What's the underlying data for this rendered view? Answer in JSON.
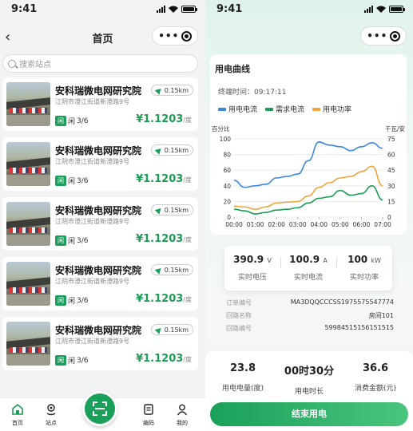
{
  "left": {
    "status_time": "9:41",
    "title": "首页",
    "search_placeholder": "搜索站点",
    "stations": [
      {
        "name": "安科瑞微电网研究院",
        "address": "江阴市澄江街道新澄路9号",
        "distance": "0.15km",
        "free_tag": "闲",
        "free_label": "闲",
        "available": "3/6",
        "price": "¥1.1203",
        "price_unit": "/度"
      },
      {
        "name": "安科瑞微电网研究院",
        "address": "江阴市澄江街道新澄路9号",
        "distance": "0.15km",
        "free_tag": "闲",
        "free_label": "闲",
        "available": "3/6",
        "price": "¥1.1203",
        "price_unit": "/度"
      },
      {
        "name": "安科瑞微电网研究院",
        "address": "江阴市澄江街道新澄路9号",
        "distance": "0.15km",
        "free_tag": "闲",
        "free_label": "闲",
        "available": "3/6",
        "price": "¥1.1203",
        "price_unit": "/度"
      },
      {
        "name": "安科瑞微电网研究院",
        "address": "江阴市澄江街道新澄路9号",
        "distance": "0.15km",
        "free_tag": "闲",
        "free_label": "闲",
        "available": "3/6",
        "price": "¥1.1203",
        "price_unit": "/度"
      },
      {
        "name": "安科瑞微电网研究院",
        "address": "江阴市澄江街道新澄路9号",
        "distance": "0.15km",
        "free_tag": "闲",
        "free_label": "闲",
        "available": "3/6",
        "price": "¥1.1203",
        "price_unit": "/度"
      }
    ],
    "tabs": [
      {
        "label": "首页",
        "icon": "home-icon"
      },
      {
        "label": "站点",
        "icon": "location-icon"
      },
      {
        "label": "编码",
        "icon": "code-icon"
      },
      {
        "label": "我的",
        "icon": "user-icon"
      }
    ],
    "scan_icon": "scan-icon"
  },
  "right": {
    "status_time": "9:41",
    "chart_title": "用电曲线",
    "terminal_time_label": "终端时间：",
    "terminal_time": "09:17:11",
    "stats": [
      {
        "value": "390.9",
        "unit": "V",
        "label": "实时电压"
      },
      {
        "value": "100.9",
        "unit": "A",
        "label": "实时电流"
      },
      {
        "value": "100",
        "unit": "kW",
        "label": "实时功率"
      }
    ],
    "info": [
      {
        "key": "订单编号",
        "value": "MA3DQQCCCSS1975575547774"
      },
      {
        "key": "回路名称",
        "value": "房间101"
      },
      {
        "key": "回路编号",
        "value": "59984515156151515"
      }
    ],
    "bottom_stats": [
      {
        "value": "23.8",
        "label": "用电电量(度)"
      },
      {
        "value": "00时30分",
        "label": "用电时长"
      },
      {
        "value": "36.6",
        "label": "消费金额(元)"
      }
    ],
    "end_button": "结束用电"
  },
  "chart_data": {
    "type": "line",
    "title": "用电曲线",
    "x": [
      "00:00",
      "01:00",
      "02:00",
      "03:00",
      "04:00",
      "05:00",
      "06:00",
      "07:00"
    ],
    "ylabel_left": "百分比",
    "ylabel_right": "千瓦/安",
    "ylim_left": [
      0,
      100
    ],
    "ylim_right": [
      0,
      75
    ],
    "yticks_left": [
      "0",
      "20",
      "40",
      "60",
      "80",
      "100"
    ],
    "yticks_right": [
      "0",
      "15",
      "30",
      "45",
      "60",
      "75"
    ],
    "grid": true,
    "legend": "top-left",
    "series": [
      {
        "name": "用电电流",
        "color": "#3b86e0",
        "x": [
          0,
          0.5,
          1,
          1.5,
          2,
          2.5,
          3,
          3.5,
          4,
          4.5,
          5,
          5.5,
          6,
          6.5,
          7
        ],
        "values": [
          47,
          38,
          40,
          42,
          50,
          52,
          55,
          72,
          96,
          92,
          90,
          85,
          90,
          95,
          88
        ]
      },
      {
        "name": "需求电流",
        "color": "#1a9d55",
        "x": [
          0,
          0.5,
          1,
          1.5,
          2,
          2.5,
          3,
          3.5,
          4,
          4.5,
          5,
          5.5,
          6,
          6.5,
          7
        ],
        "values": [
          10,
          8,
          4,
          6,
          9,
          10,
          12,
          18,
          24,
          26,
          34,
          28,
          30,
          40,
          22
        ]
      },
      {
        "name": "用电功率",
        "color": "#f0a43a",
        "x": [
          0,
          0.5,
          1,
          1.5,
          2,
          2.5,
          3,
          3.5,
          4,
          4.5,
          5,
          5.5,
          6,
          6.5,
          7
        ],
        "values": [
          14,
          13,
          10,
          13,
          18,
          19,
          20,
          27,
          38,
          44,
          50,
          52,
          58,
          65,
          40
        ]
      }
    ]
  }
}
